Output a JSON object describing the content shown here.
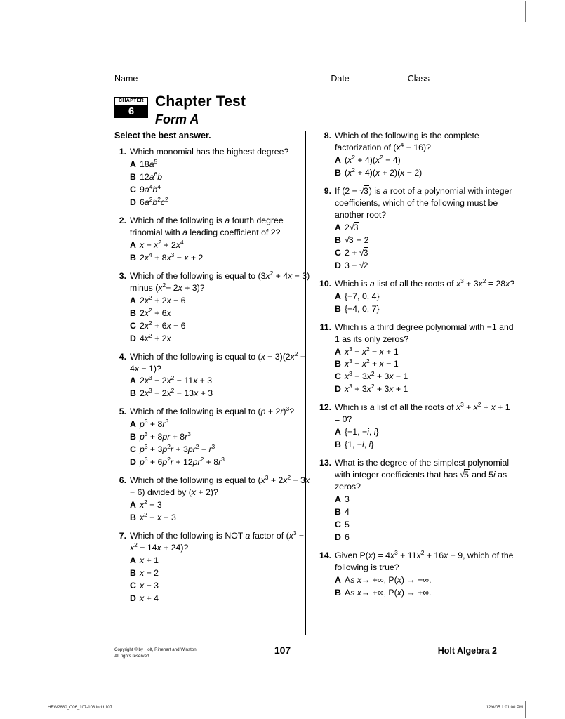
{
  "header": {
    "name_label": "Name",
    "date_label": "Date",
    "class_label": "Class"
  },
  "masthead": {
    "chapter_label": "CHAPTER",
    "chapter_number": "6",
    "title": "Chapter Test",
    "subtitle": "Form A"
  },
  "instruction": "Select the best answer.",
  "questions": [
    {
      "number": "1.",
      "text": "Which monomial has the highest degree?",
      "choices": [
        {
          "letter": "A",
          "text": "18a⁵"
        },
        {
          "letter": "B",
          "text": "12a⁶b"
        },
        {
          "letter": "C",
          "text": "9a⁴b⁴"
        },
        {
          "letter": "D",
          "text": "6a²b²c²"
        }
      ]
    },
    {
      "number": "2.",
      "text": "Which of the following is a fourth degree trinomial with a leading coefficient of 2?",
      "choices": [
        {
          "letter": "A",
          "text": "x − x² + 2x⁴"
        },
        {
          "letter": "B",
          "text": "2x⁴ + 8x³ − x + 2"
        }
      ]
    },
    {
      "number": "3.",
      "text": "Which of the following is equal to (3x² + 4x − 3) minus (x²− 2x + 3)?",
      "choices": [
        {
          "letter": "A",
          "text": "2x² + 2x − 6"
        },
        {
          "letter": "B",
          "text": "2x² + 6x"
        },
        {
          "letter": "C",
          "text": "2x² + 6x − 6"
        },
        {
          "letter": "D",
          "text": "4x² + 2x"
        }
      ]
    },
    {
      "number": "4.",
      "text": "Which of the following is equal to (x − 3)(2x² + 4x − 1)?",
      "choices": [
        {
          "letter": "A",
          "text": "2x³ − 2x² − 11x + 3"
        },
        {
          "letter": "B",
          "text": "2x³ − 2x² − 13x + 3"
        }
      ]
    },
    {
      "number": "5.",
      "text": "Which of the following is equal to (p + 2r)³?",
      "choices": [
        {
          "letter": "A",
          "text": "p³ + 8r³"
        },
        {
          "letter": "B",
          "text": "p³ + 8pr + 8r³"
        },
        {
          "letter": "C",
          "text": "p³ + 3p²r + 3pr² + r³"
        },
        {
          "letter": "D",
          "text": "p³ + 6p²r + 12pr² + 8r³"
        }
      ]
    },
    {
      "number": "6.",
      "text": "Which of the following is equal to (x³ + 2x² − 3x − 6) divided by (x + 2)?",
      "choices": [
        {
          "letter": "A",
          "text": "x² − 3"
        },
        {
          "letter": "B",
          "text": "x² − x − 3"
        }
      ]
    },
    {
      "number": "7.",
      "text": "Which of the following is NOT a factor of (x³ − x² − 14x + 24)?",
      "choices": [
        {
          "letter": "A",
          "text": "x + 1"
        },
        {
          "letter": "B",
          "text": "x − 2"
        },
        {
          "letter": "C",
          "text": "x − 3"
        },
        {
          "letter": "D",
          "text": "x + 4"
        }
      ]
    },
    {
      "number": "8.",
      "text": "Which of the following is the complete factorization of (x⁴ − 16)?",
      "choices": [
        {
          "letter": "A",
          "text": "(x² + 4)(x² − 4)"
        },
        {
          "letter": "B",
          "text": "(x² + 4)(x + 2)(x − 2)"
        }
      ]
    },
    {
      "number": "9.",
      "text": "If (2 − √3) is a root of a polynomial with integer coefficients, which of the following must be another root?",
      "choices": [
        {
          "letter": "A",
          "text": "2√3"
        },
        {
          "letter": "B",
          "text": "√3 − 2"
        },
        {
          "letter": "C",
          "text": "2 + √3"
        },
        {
          "letter": "D",
          "text": "3 − √2"
        }
      ]
    },
    {
      "number": "10.",
      "text": "Which is a list of all the roots of x³ + 3x² = 28x?",
      "choices": [
        {
          "letter": "A",
          "text": "{−7, 0, 4}"
        },
        {
          "letter": "B",
          "text": "{−4, 0, 7}"
        }
      ]
    },
    {
      "number": "11.",
      "text": "Which is a third degree polynomial with −1 and 1 as its only zeros?",
      "choices": [
        {
          "letter": "A",
          "text": "x³ − x² − x + 1"
        },
        {
          "letter": "B",
          "text": "x³ − x² + x − 1"
        },
        {
          "letter": "C",
          "text": "x³ − 3x² + 3x − 1"
        },
        {
          "letter": "D",
          "text": "x³ + 3x² + 3x + 1"
        }
      ]
    },
    {
      "number": "12.",
      "text": "Which is a list of all the roots of x³ + x² + x + 1 = 0?",
      "choices": [
        {
          "letter": "A",
          "text": "{−1, −i, i}"
        },
        {
          "letter": "B",
          "text": "{1, −i, i}"
        }
      ]
    },
    {
      "number": "13.",
      "text": "What is the degree of the simplest polynomial with integer coefficients that has √5 and 5i as zeros?",
      "choices": [
        {
          "letter": "A",
          "text": "3"
        },
        {
          "letter": "B",
          "text": "4"
        },
        {
          "letter": "C",
          "text": "5"
        },
        {
          "letter": "D",
          "text": "6"
        }
      ]
    },
    {
      "number": "14.",
      "text": "Given P(x) = 4x³ + 11x² + 16x − 9, which of the following is true?",
      "choices": [
        {
          "letter": "A",
          "text": "As x→ +∞, P(x) → −∞."
        },
        {
          "letter": "B",
          "text": "As x→ +∞, P(x) → +∞."
        }
      ]
    }
  ],
  "footer": {
    "copyright_line1": "Copyright © by Holt, Rinehart and Winston.",
    "copyright_line2": "All rights reserved.",
    "page_number": "107",
    "brand": "Holt Algebra 2",
    "print_file": "HRW2880_C06_107-108.indd   107",
    "print_stamp": "12/6/05   1:01:00 PM"
  }
}
